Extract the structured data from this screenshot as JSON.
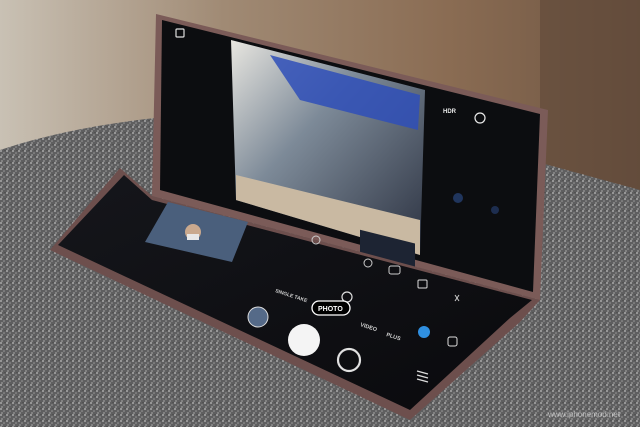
{
  "camera_ui": {
    "top_bar": {
      "hdr_label": "HDR"
    },
    "modes": {
      "single_take": "SINGLE TAKE",
      "photo": "PHOTO",
      "video": "VIDEO",
      "more": "PLUS"
    },
    "icons": [
      "gallery-icon",
      "shutter-button-icon",
      "switch-camera-icon",
      "settings-icon",
      "flash-icon",
      "timer-icon",
      "aspect-ratio-icon",
      "motion-photo-icon",
      "filter-icon",
      "effects-icon",
      "zoom-icon",
      "menu-icon"
    ]
  },
  "watermark": {
    "text": "www.iphonemod.net"
  },
  "colors": {
    "phone_frame": "#7a5a57",
    "screen": "#0c0d10",
    "fabric": "#6e6e6e",
    "wall": "#8a6e58",
    "photo_pill": "#ffffff"
  }
}
